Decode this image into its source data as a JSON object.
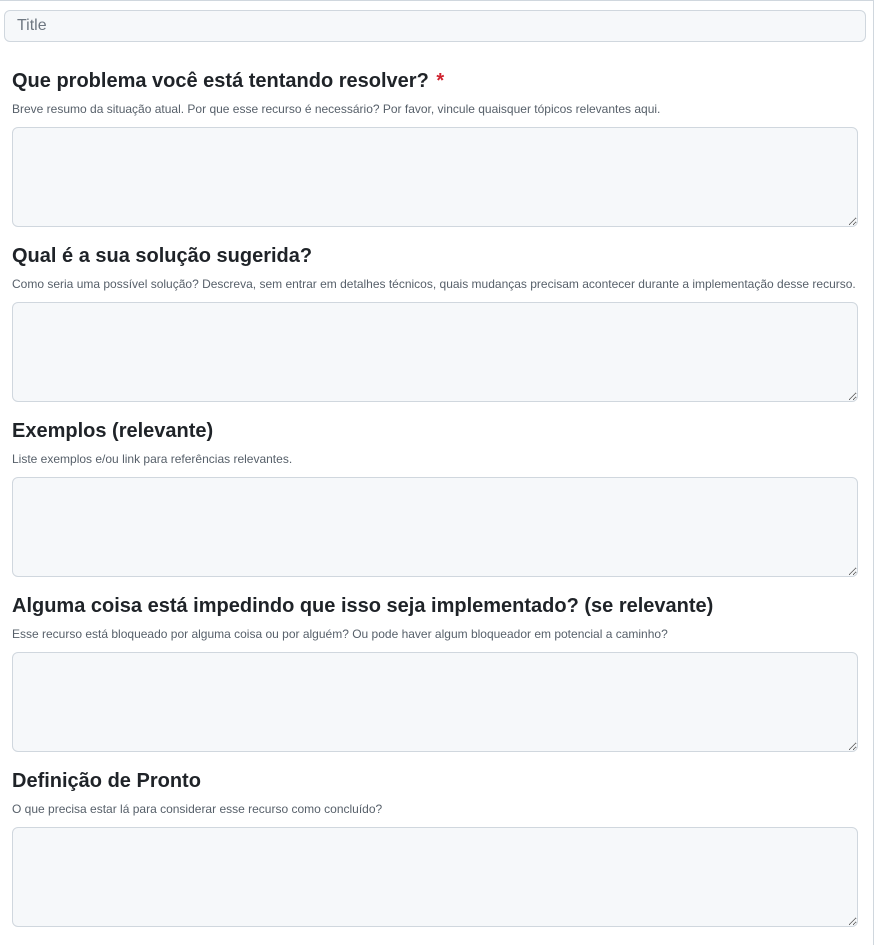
{
  "title_input": {
    "placeholder": "Title",
    "value": ""
  },
  "fields": [
    {
      "label": "Que problema você está tentando resolver?",
      "required_marker": "*",
      "help": "Breve resumo da situação atual. Por que esse recurso é necessário? Por favor, vincule quaisquer tópicos relevantes aqui.",
      "value": ""
    },
    {
      "label": "Qual é a sua solução sugerida?",
      "help": "Como seria uma possível solução? Descreva, sem entrar em detalhes técnicos, quais mudanças precisam acontecer durante a implementação desse recurso.",
      "value": ""
    },
    {
      "label": "Exemplos (relevante)",
      "help": "Liste exemplos e/ou link para referências relevantes.",
      "value": ""
    },
    {
      "label": "Alguma coisa está impedindo que isso seja implementado? (se relevante)",
      "help": "Esse recurso está bloqueado por alguma coisa ou por alguém? Ou pode haver algum bloqueador em potencial a caminho?",
      "value": ""
    },
    {
      "label": "Definição de Pronto",
      "help": "O que precisa estar lá para considerar esse recurso como concluído?",
      "value": ""
    }
  ],
  "colors": {
    "required": "#cf222e",
    "input_background": "#f6f8fa",
    "border": "#d0d7de",
    "help_text": "#57606a"
  }
}
